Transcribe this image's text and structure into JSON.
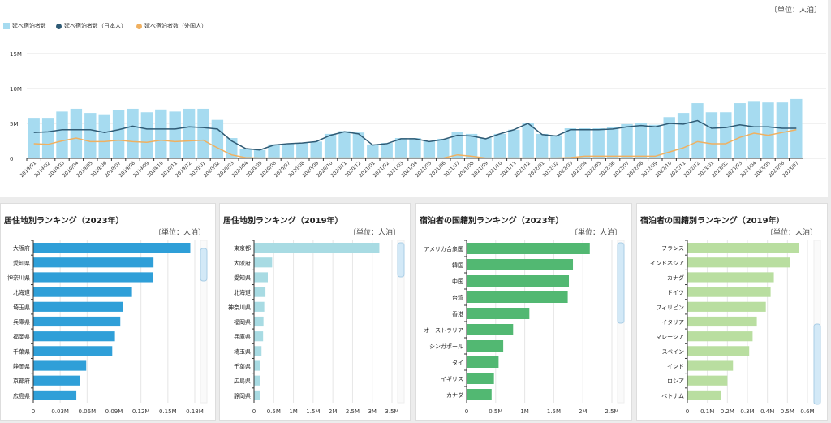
{
  "unit_label": "〔単位：人泊〕",
  "chart_data": [
    {
      "type": "bar+line",
      "title": "",
      "legend": [
        "延べ宿泊者数",
        "延べ宿泊者数（日本人）",
        "延べ宿泊者数（外国人）"
      ],
      "colors": {
        "total": "#a6dbf0",
        "japanese": "#2f5b75",
        "foreign": "#f0b060"
      },
      "yticks": [
        "0",
        "5M",
        "10M",
        "15M"
      ],
      "ylim": [
        0,
        15
      ],
      "yunit": "M",
      "x": [
        "2019/01",
        "2019/02",
        "2019/03",
        "2019/04",
        "2019/05",
        "2019/06",
        "2019/07",
        "2019/08",
        "2019/09",
        "2019/10",
        "2019/11",
        "2019/12",
        "2020/01",
        "2020/02",
        "2020/03",
        "2020/04",
        "2020/05",
        "2020/06",
        "2020/07",
        "2020/08",
        "2020/09",
        "2020/10",
        "2020/11",
        "2020/12",
        "2021/01",
        "2021/02",
        "2021/03",
        "2021/04",
        "2021/05",
        "2021/06",
        "2021/07",
        "2021/08",
        "2021/09",
        "2021/10",
        "2021/11",
        "2021/12",
        "2022/01",
        "2022/02",
        "2022/03",
        "2022/04",
        "2022/05",
        "2022/06",
        "2022/07",
        "2022/08",
        "2022/09",
        "2022/10",
        "2022/11",
        "2022/12",
        "2023/01",
        "2023/02",
        "2023/03",
        "2023/04",
        "2023/05",
        "2023/06",
        "2023/07"
      ],
      "series": [
        {
          "name": "延べ宿泊者数",
          "type": "bar",
          "values": [
            5.8,
            5.8,
            6.7,
            7.1,
            6.5,
            6.2,
            6.9,
            7.1,
            6.6,
            7.0,
            6.7,
            7.1,
            7.1,
            5.5,
            2.9,
            1.4,
            1.2,
            2.0,
            2.1,
            2.2,
            2.4,
            3.5,
            3.9,
            3.7,
            2.0,
            2.2,
            2.9,
            2.9,
            2.5,
            2.8,
            3.8,
            3.5,
            2.9,
            3.5,
            4.1,
            5.1,
            3.5,
            3.3,
            4.3,
            4.3,
            4.3,
            4.5,
            4.9,
            5.0,
            4.8,
            5.9,
            6.5,
            7.9,
            6.6,
            6.6,
            7.9,
            8.1,
            8.0,
            8.0,
            8.5
          ]
        },
        {
          "name": "延べ宿泊者数（日本人）",
          "type": "line",
          "values": [
            3.7,
            3.8,
            4.1,
            4.1,
            4.1,
            3.7,
            4.1,
            4.6,
            4.2,
            4.2,
            4.2,
            4.5,
            4.4,
            4.2,
            2.5,
            1.4,
            1.2,
            1.9,
            2.1,
            2.2,
            2.4,
            3.3,
            3.8,
            3.5,
            1.9,
            2.1,
            2.8,
            2.8,
            2.4,
            2.7,
            3.3,
            3.2,
            2.8,
            3.5,
            4.1,
            5.0,
            3.4,
            3.2,
            4.1,
            4.1,
            4.1,
            4.2,
            4.5,
            4.7,
            4.5,
            5.0,
            4.9,
            5.4,
            4.3,
            4.4,
            4.8,
            4.5,
            4.5,
            4.3,
            4.3
          ]
        },
        {
          "name": "延べ宿泊者数（外国人）",
          "type": "line",
          "values": [
            2.1,
            2.0,
            2.5,
            2.9,
            2.4,
            2.4,
            2.6,
            2.4,
            2.3,
            2.6,
            2.4,
            2.5,
            2.6,
            1.5,
            0.5,
            0.1,
            0.05,
            0.05,
            0.05,
            0.05,
            0.05,
            0.05,
            0.05,
            0.05,
            0.05,
            0.05,
            0.05,
            0.05,
            0.05,
            0.05,
            0.5,
            0.3,
            0.05,
            0.05,
            0.05,
            0.05,
            0.05,
            0.05,
            0.1,
            0.3,
            0.3,
            0.3,
            0.3,
            0.3,
            0.3,
            0.9,
            1.5,
            2.4,
            2.1,
            2.1,
            3.0,
            3.6,
            3.3,
            3.7,
            4.1
          ]
        }
      ]
    },
    {
      "type": "bar",
      "orientation": "horizontal",
      "title": "居住地別ランキング（2023年）",
      "color": "#2f9fd8",
      "xlim": [
        0,
        0.18
      ],
      "xticks": [
        [
          0,
          "0"
        ],
        [
          0.03,
          "0.03M"
        ],
        [
          0.06,
          "0.06M"
        ],
        [
          0.09,
          "0.09M"
        ],
        [
          0.12,
          "0.12M"
        ],
        [
          0.15,
          "0.15M"
        ],
        [
          0.18,
          "0.18M"
        ]
      ],
      "categories": [
        "大阪府",
        "愛知県",
        "神奈川県",
        "北海道",
        "埼玉県",
        "兵庫県",
        "福岡県",
        "千葉県",
        "静岡県",
        "京都府",
        "広島県"
      ],
      "values": [
        0.175,
        0.134,
        0.133,
        0.11,
        0.1,
        0.097,
        0.091,
        0.088,
        0.059,
        0.052,
        0.048
      ],
      "unit": "M"
    },
    {
      "type": "bar",
      "orientation": "horizontal",
      "title": "居住地別ランキング（2019年）",
      "color": "#a8dbe3",
      "xlim": [
        0,
        3.5
      ],
      "xticks": [
        [
          0,
          "0"
        ],
        [
          0.5,
          "0.5M"
        ],
        [
          1,
          "1M"
        ],
        [
          1.5,
          "1.5M"
        ],
        [
          2,
          "2M"
        ],
        [
          2.5,
          "2.5M"
        ],
        [
          3,
          "3M"
        ],
        [
          3.5,
          "3.5M"
        ]
      ],
      "categories": [
        "東京都",
        "大阪府",
        "愛知県",
        "北海道",
        "神奈川県",
        "福岡県",
        "兵庫県",
        "埼玉県",
        "千葉県",
        "広島県",
        "静岡県"
      ],
      "values": [
        3.18,
        0.46,
        0.35,
        0.29,
        0.26,
        0.24,
        0.23,
        0.19,
        0.16,
        0.15,
        0.15
      ],
      "unit": "M"
    },
    {
      "type": "bar",
      "orientation": "horizontal",
      "title": "宿泊者の国籍別ランキング（2023年）",
      "color": "#52b872",
      "xlim": [
        0,
        2.5
      ],
      "xticks": [
        [
          0,
          "0"
        ],
        [
          0.5,
          "0.5M"
        ],
        [
          1,
          "1M"
        ],
        [
          1.5,
          "1.5M"
        ],
        [
          2,
          "2M"
        ],
        [
          2.5,
          "2.5M"
        ]
      ],
      "categories": [
        "アメリカ合衆国",
        "韓国",
        "中国",
        "台湾",
        "香港",
        "オーストラリア",
        "シンガポール",
        "タイ",
        "イギリス",
        "カナダ"
      ],
      "values": [
        2.12,
        1.83,
        1.76,
        1.74,
        1.08,
        0.8,
        0.63,
        0.55,
        0.47,
        0.43
      ],
      "unit": "M"
    },
    {
      "type": "bar",
      "orientation": "horizontal",
      "title": "宿泊者の国籍別ランキング（2019年）",
      "color": "#b9dea0",
      "xlim": [
        0,
        0.6
      ],
      "xticks": [
        [
          0,
          "0"
        ],
        [
          0.1,
          "0.1M"
        ],
        [
          0.2,
          "0.2M"
        ],
        [
          0.3,
          "0.3M"
        ],
        [
          0.4,
          "0.4M"
        ],
        [
          0.5,
          "0.5M"
        ],
        [
          0.6,
          "0.6M"
        ]
      ],
      "categories": [
        "フランス",
        "インドネシア",
        "カナダ",
        "ドイツ",
        "フィリピン",
        "イタリア",
        "マレーシア",
        "スペイン",
        "インド",
        "ロシア",
        "ベトナム"
      ],
      "values": [
        0.557,
        0.512,
        0.432,
        0.416,
        0.392,
        0.347,
        0.326,
        0.309,
        0.228,
        0.2,
        0.169
      ],
      "unit": "M"
    }
  ]
}
